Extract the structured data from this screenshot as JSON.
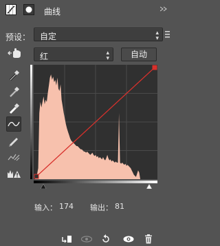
{
  "header": {
    "title": "曲线"
  },
  "preset": {
    "label": "预设：",
    "value": "自定"
  },
  "channel": {
    "value": "红",
    "auto_label": "自动"
  },
  "readout": {
    "input_label": "输入：",
    "input_value": "174",
    "output_label": "输出：",
    "output_value": "81"
  },
  "icons": {
    "adjustment": "curves-adjustment-icon",
    "mask": "layer-mask-icon",
    "on_image": "on-image-adjust-hand-icon",
    "black_point": "sample-black-point-eyedropper-icon",
    "gray_point": "sample-gray-point-eyedropper-icon",
    "white_point": "sample-white-point-eyedropper-icon",
    "curve_tool": "edit-points-curve-icon",
    "pencil": "draw-pencil-icon",
    "smooth": "smooth-curve-icon",
    "clipping": "clipping-warning-icon",
    "clip_to_layer": "clip-to-layer-icon",
    "view_previous": "view-previous-state-icon",
    "reset": "reset-icon",
    "visibility": "visibility-eye-icon",
    "delete": "trash-icon"
  },
  "colors": {
    "panel_bg": "#535353",
    "histogram": "#f7c1ad",
    "curve": "#d9302b",
    "graph_bg": "#303030"
  },
  "chart_data": {
    "type": "area",
    "channel": "红",
    "xlim": [
      0,
      255
    ],
    "ylim": [
      0,
      255
    ],
    "curve_points": [
      [
        0,
        0
      ],
      [
        255,
        255
      ]
    ],
    "baseline": [
      [
        0,
        0
      ],
      [
        255,
        255
      ]
    ],
    "histogram": [
      0,
      0.02,
      0.05,
      0.1,
      0.6,
      0.7,
      0.65,
      0.7,
      0.75,
      0.68,
      0.72,
      0.7,
      0.78,
      0.85,
      0.92,
      0.95,
      0.9,
      0.93,
      0.88,
      0.9,
      0.85,
      0.92,
      0.82,
      0.8,
      0.86,
      0.72,
      0.66,
      0.6,
      0.55,
      0.5,
      0.46,
      0.43,
      0.4,
      0.37,
      0.35,
      0.34,
      0.33,
      0.32,
      0.31,
      0.3,
      0.3,
      0.29,
      0.28,
      0.27,
      0.27,
      0.26,
      0.25,
      0.25,
      0.24,
      0.25,
      0.24,
      0.23,
      0.22,
      0.23,
      0.24,
      0.22,
      0.21,
      0.22,
      0.2,
      0.21,
      0.19,
      0.2,
      0.19,
      0.18,
      0.2,
      0.18,
      0.17,
      0.19,
      0.22,
      0.19,
      0.17,
      0.18,
      0.16,
      0.17,
      0.16,
      0.15,
      0.16,
      0.15,
      0.15,
      0.6,
      0.15,
      0.14,
      0.15,
      0.14,
      0.13,
      0.14,
      0.12,
      0.13,
      0.12,
      0.11,
      0.1,
      0.08,
      0.06,
      0.04,
      0.03,
      0.02,
      0.05,
      0.08,
      0.06,
      0
    ]
  }
}
